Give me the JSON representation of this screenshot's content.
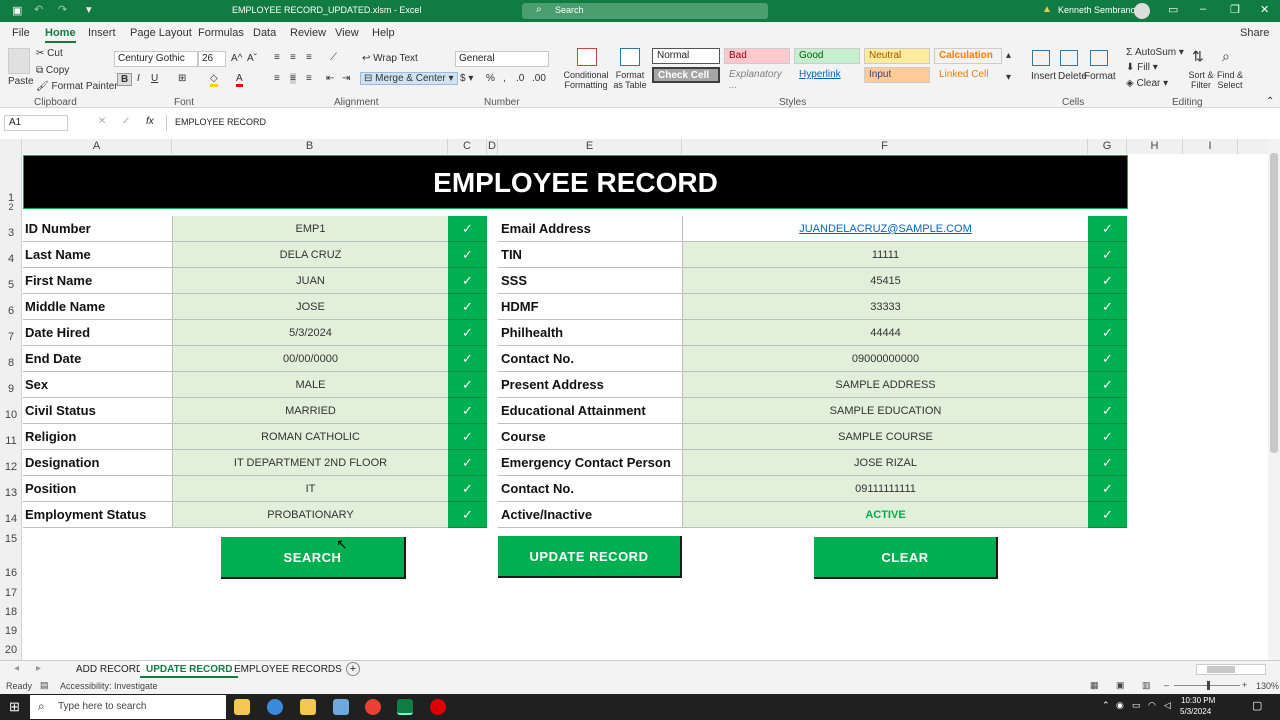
{
  "window": {
    "title": "EMPLOYEE RECORD_UPDATED.xlsm  -  Excel",
    "search_placeholder": "Search",
    "user": "Kenneth Sembrano"
  },
  "ribbon_tabs": [
    "File",
    "Home",
    "Insert",
    "Page Layout",
    "Formulas",
    "Data",
    "Review",
    "View",
    "Help"
  ],
  "share_label": "Share",
  "ribbon": {
    "clipboard": {
      "cut": "Cut",
      "copy": "Copy",
      "format_painter": "Format Painter",
      "paste": "Paste",
      "label": "Clipboard"
    },
    "font": {
      "name": "Century Gothic",
      "size": "26",
      "label": "Font"
    },
    "alignment": {
      "wrap": "Wrap Text",
      "merge": "Merge & Center",
      "label": "Alignment"
    },
    "number": {
      "format": "General",
      "label": "Number"
    },
    "styles": {
      "cond_fmt": "Conditional Formatting",
      "format_table": "Format as Table",
      "cells": [
        "Normal",
        "Bad",
        "Good",
        "Neutral",
        "Calculation",
        "Check Cell",
        "Explanatory ...",
        "Hyperlink",
        "Input",
        "Linked Cell"
      ],
      "label": "Styles"
    },
    "cells_group": {
      "insert": "Insert",
      "delete": "Delete",
      "format": "Format",
      "label": "Cells"
    },
    "editing": {
      "autosum": "AutoSum",
      "fill": "Fill",
      "clear": "Clear",
      "sort": "Sort & Filter",
      "find": "Find & Select",
      "label": "Editing"
    }
  },
  "formula_bar": {
    "cell_ref": "A1",
    "fx": "fx",
    "content": "EMPLOYEE RECORD"
  },
  "columns": [
    "A",
    "B",
    "C",
    "D",
    "E",
    "F",
    "G",
    "H",
    "I"
  ],
  "rows": [
    "1",
    "2",
    "3",
    "4",
    "5",
    "6",
    "7",
    "8",
    "9",
    "10",
    "11",
    "12",
    "13",
    "14",
    "15",
    "16",
    "17",
    "18",
    "19",
    "20"
  ],
  "sheet": {
    "header": "EMPLOYEE RECORD",
    "left_fields": [
      {
        "label": "ID Number",
        "value": "EMP1"
      },
      {
        "label": "Last Name",
        "value": "DELA CRUZ"
      },
      {
        "label": "First Name",
        "value": "JUAN"
      },
      {
        "label": "Middle Name",
        "value": "JOSE"
      },
      {
        "label": "Date Hired",
        "value": "5/3/2024"
      },
      {
        "label": "End Date",
        "value": "00/00/0000"
      },
      {
        "label": "Sex",
        "value": "MALE"
      },
      {
        "label": "Civil Status",
        "value": "MARRIED"
      },
      {
        "label": "Religion",
        "value": "ROMAN CATHOLIC"
      },
      {
        "label": "Designation",
        "value": "IT DEPARTMENT 2ND FLOOR"
      },
      {
        "label": "Position",
        "value": "IT"
      },
      {
        "label": "Employment Status",
        "value": "PROBATIONARY"
      }
    ],
    "right_fields": [
      {
        "label": "Email Address",
        "value": "JUANDELACRUZ@SAMPLE.COM"
      },
      {
        "label": "TIN",
        "value": "11111"
      },
      {
        "label": "SSS",
        "value": "45415"
      },
      {
        "label": "HDMF",
        "value": "33333"
      },
      {
        "label": "Philhealth",
        "value": "44444"
      },
      {
        "label": "Contact No.",
        "value": "09000000000"
      },
      {
        "label": "Present Address",
        "value": "SAMPLE ADDRESS"
      },
      {
        "label": "Educational Attainment",
        "value": "SAMPLE EDUCATION"
      },
      {
        "label": "Course",
        "value": "SAMPLE COURSE"
      },
      {
        "label": "Emergency Contact Person",
        "value": "JOSE RIZAL"
      },
      {
        "label": "Contact No.",
        "value": "09111111111"
      },
      {
        "label": "Active/Inactive",
        "value": "ACTIVE"
      }
    ],
    "check": "✓",
    "buttons": {
      "search": "SEARCH",
      "update": "UPDATE RECORD",
      "clear": "CLEAR"
    }
  },
  "sheet_tabs": [
    "ADD RECORD",
    "UPDATE RECORD",
    "EMPLOYEE RECORDS"
  ],
  "active_sheet": "UPDATE RECORD",
  "status": {
    "ready": "Ready",
    "accessibility": "Accessibility: Investigate",
    "zoom": "130%"
  },
  "taskbar": {
    "search": "Type here to search",
    "time": "10:30 PM",
    "date": "5/3/2024"
  },
  "colors": {
    "green": "#00b050",
    "excel_green": "#107c41",
    "light_green": "#e2efda",
    "header_bg": "#000000",
    "hyperlink": "#0563c1"
  }
}
